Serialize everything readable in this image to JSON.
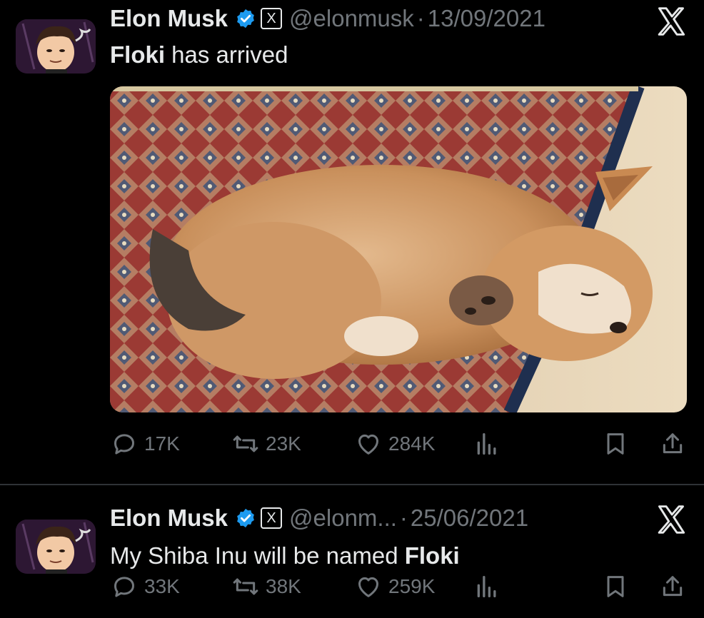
{
  "tweets": [
    {
      "author": {
        "name": "Elon Musk",
        "handle": "@elonmusk",
        "verified": true,
        "avatar_icon": "avatar-illustration-icon",
        "affiliation_badge": "X"
      },
      "separator": "·",
      "date": "13/09/2021",
      "text_parts": [
        {
          "text": "Floki",
          "bold": true
        },
        {
          "text": " has arrived",
          "bold": false
        }
      ],
      "media": {
        "description_icon": "shiba-puppy-on-rug-photo"
      },
      "stats": {
        "replies": "17K",
        "reposts": "23K",
        "likes": "284K"
      }
    },
    {
      "author": {
        "name": "Elon Musk",
        "handle": "@elonm...",
        "verified": true,
        "avatar_icon": "avatar-illustration-icon",
        "affiliation_badge": "X"
      },
      "separator": "·",
      "date": "25/06/2021",
      "text_parts": [
        {
          "text": "My Shiba Inu will be named ",
          "bold": false
        },
        {
          "text": "Floki",
          "bold": true
        }
      ],
      "stats": {
        "replies": "33K",
        "reposts": "38K",
        "likes": "259K"
      }
    }
  ],
  "colors": {
    "background": "#000000",
    "text": "#e7e9ea",
    "muted": "#71767b",
    "verified_blue": "#1d9bf0",
    "divider": "#2f3336"
  }
}
